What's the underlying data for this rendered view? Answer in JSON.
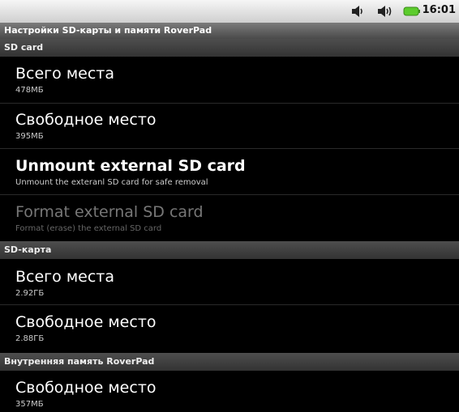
{
  "status_bar": {
    "time": "16:01",
    "icons": [
      "volume-icon",
      "volume-icon",
      "battery-icon"
    ],
    "battery_color": "#5ccc2c"
  },
  "title_bar": {
    "title": "Настройки SD-карты и памяти RoverPad"
  },
  "sections": [
    {
      "header": "SD card",
      "items": [
        {
          "title": "Всего места",
          "summary": "478МБ"
        },
        {
          "title": "Свободное место",
          "summary": "395МБ"
        },
        {
          "title": "Unmount external SD card",
          "summary": "Unmount the exteranl SD card for safe removal"
        },
        {
          "title": "Format external SD card",
          "summary": "Format (erase) the external SD card"
        }
      ]
    },
    {
      "header": "SD-карта",
      "items": [
        {
          "title": "Всего места",
          "summary": "2.92ГБ"
        },
        {
          "title": "Свободное место",
          "summary": "2.88ГБ"
        }
      ]
    },
    {
      "header": "Внутренняя память RoverPad",
      "items": [
        {
          "title": "Свободное место",
          "summary": "357МБ"
        }
      ]
    }
  ]
}
